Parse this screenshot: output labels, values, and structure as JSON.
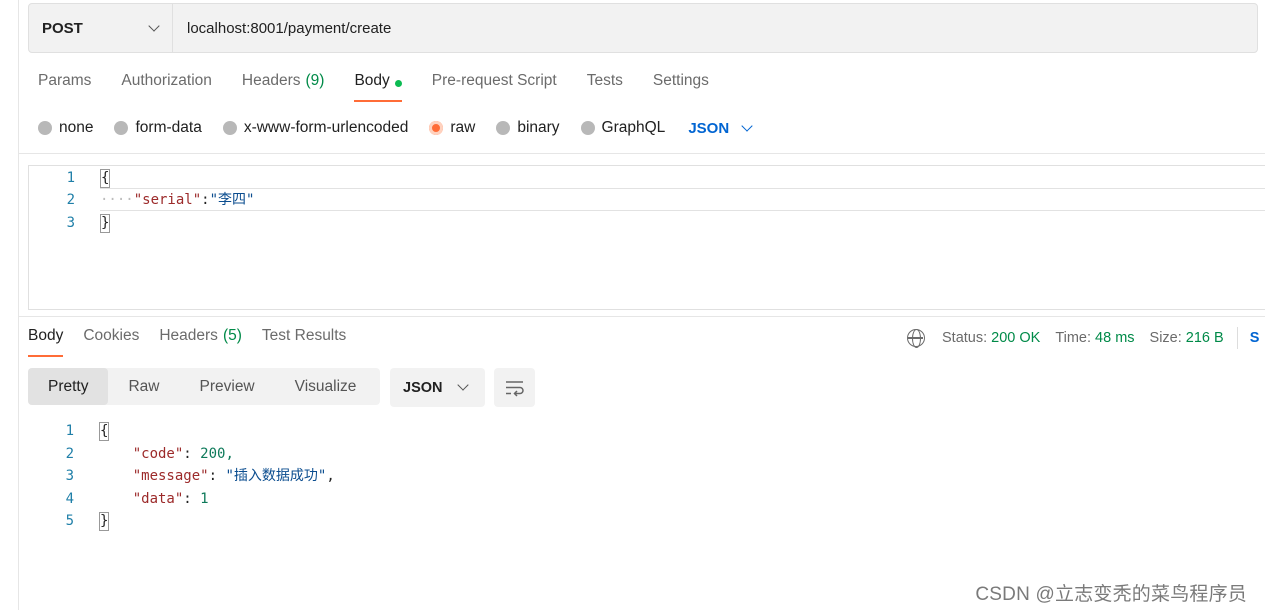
{
  "request": {
    "method": "POST",
    "url": "localhost:8001/payment/create",
    "tabs": [
      {
        "label": "Params"
      },
      {
        "label": "Authorization"
      },
      {
        "label": "Headers",
        "count": "(9)"
      },
      {
        "label": "Body",
        "active": true
      },
      {
        "label": "Pre-request Script"
      },
      {
        "label": "Tests"
      },
      {
        "label": "Settings"
      }
    ],
    "body_modes": [
      "none",
      "form-data",
      "x-www-form-urlencoded",
      "raw",
      "binary",
      "GraphQL"
    ],
    "selected_mode": "raw",
    "language": "JSON",
    "body_lines": [
      {
        "n": "1",
        "open": "{"
      },
      {
        "n": "2",
        "key": "\"serial\"",
        "colon": ":",
        "value": "\"李四\""
      },
      {
        "n": "3",
        "close": "}"
      }
    ]
  },
  "response": {
    "tabs": [
      {
        "label": "Body",
        "active": true
      },
      {
        "label": "Cookies"
      },
      {
        "label": "Headers",
        "count": "(5)"
      },
      {
        "label": "Test Results"
      }
    ],
    "status_label": "Status:",
    "status_value": "200 OK",
    "time_label": "Time:",
    "time_value": "48 ms",
    "size_label": "Size:",
    "size_value": "216 B",
    "save_peek": "S",
    "views": [
      "Pretty",
      "Raw",
      "Preview",
      "Visualize"
    ],
    "active_view": "Pretty",
    "format": "JSON",
    "lines": [
      {
        "n": "1"
      },
      {
        "n": "2",
        "key": "\"code\"",
        "value": "200,"
      },
      {
        "n": "3",
        "key": "\"message\"",
        "value": "\"插入数据成功\"",
        "tail": ","
      },
      {
        "n": "4",
        "key": "\"data\"",
        "value": "1"
      },
      {
        "n": "5"
      }
    ],
    "open_brace": "{",
    "close_brace": "}",
    "colon": ":"
  },
  "watermark": "CSDN @立志变秃的菜鸟程序员",
  "colors": {
    "accent": "#ff6c37",
    "success": "#008a48",
    "link": "#0265d2"
  }
}
